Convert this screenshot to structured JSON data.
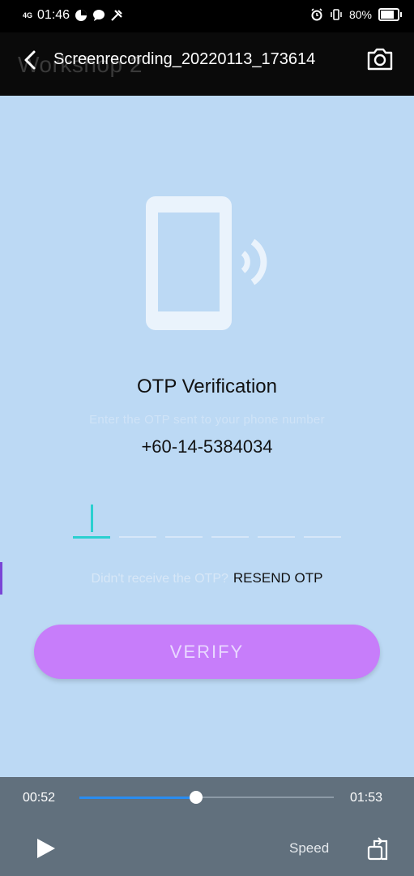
{
  "status_bar": {
    "network": "4G",
    "time": "01:46",
    "battery": "80%",
    "battery_level": 0.8
  },
  "title_bar": {
    "ghost_title": "Workshop 2",
    "file_name": "Screenrecording_20220113_173614"
  },
  "otp": {
    "title": "OTP Verification",
    "subtitle": "Enter the OTP sent to your phone number",
    "phone": "+60-14-5384034",
    "resend_prompt": "Didn't receive the OTP?",
    "resend_label": "RESEND OTP",
    "verify_label": "VERIFY",
    "digit_count": 6
  },
  "player": {
    "current_time": "00:52",
    "duration": "01:53",
    "progress": 0.46,
    "speed_label": "Speed"
  },
  "colors": {
    "background": "#bcd9f4",
    "verify_button": "#c77dfa",
    "cursor": "#2bd0d0",
    "player_bar": "#61707d",
    "seek_progress": "#2a8cf0"
  }
}
